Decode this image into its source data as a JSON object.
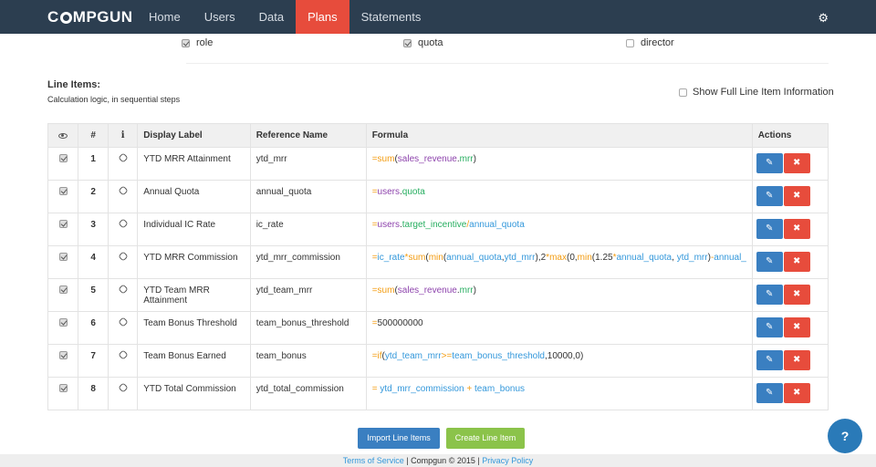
{
  "nav": {
    "brand": "COMPGUN",
    "items": [
      {
        "label": "Home",
        "active": false
      },
      {
        "label": "Users",
        "active": false
      },
      {
        "label": "Data",
        "active": false
      },
      {
        "label": "Plans",
        "active": true
      },
      {
        "label": "Statements",
        "active": false
      }
    ],
    "settings_icon": "gear-icon"
  },
  "fields": [
    {
      "label": "role",
      "checked": true
    },
    {
      "label": "quota",
      "checked": true
    },
    {
      "label": "director",
      "checked": false
    }
  ],
  "line_items": {
    "title": "Line Items:",
    "subtitle": "Calculation logic, in sequential steps",
    "show_full_label": "Show Full Line Item Information",
    "show_full_checked": false
  },
  "table": {
    "headers": {
      "visible_icon": "eye-icon",
      "num": "#",
      "info_icon": "info-icon",
      "display": "Display Label",
      "ref": "Reference Name",
      "formula": "Formula",
      "actions": "Actions"
    },
    "rows": [
      {
        "num": "1",
        "display": "YTD MRR Attainment",
        "ref": "ytd_mrr",
        "formula": "=sum(sales_revenue.mrr)"
      },
      {
        "num": "2",
        "display": "Annual Quota",
        "ref": "annual_quota",
        "formula": "=users.quota"
      },
      {
        "num": "3",
        "display": "Individual IC Rate",
        "ref": "ic_rate",
        "formula": "=users.target_incentive/annual_quota"
      },
      {
        "num": "4",
        "display": "YTD MRR Commission",
        "ref": "ytd_mrr_commission",
        "formula": "=ic_rate*sum(min(annual_quota,ytd_mrr),2*max(0,min(1.25*annual_quota, ytd_mrr)-annual_"
      },
      {
        "num": "5",
        "display": "YTD Team MRR Attainment",
        "ref": "ytd_team_mrr",
        "formula": "=sum(sales_revenue.mrr)"
      },
      {
        "num": "6",
        "display": "Team Bonus Threshold",
        "ref": "team_bonus_threshold",
        "formula": "=500000000"
      },
      {
        "num": "7",
        "display": "Team Bonus Earned",
        "ref": "team_bonus",
        "formula": "=if(ytd_team_mrr>=team_bonus_threshold,10000,0)"
      },
      {
        "num": "8",
        "display": "YTD Total Commission",
        "ref": "ytd_total_commission",
        "formula": "= ytd_mrr_commission + team_bonus"
      }
    ]
  },
  "buttons": {
    "import": "Import Line Items",
    "create": "Create Line Item"
  },
  "footer": {
    "terms": "Terms of Service",
    "middle": " | Compgun © 2015 | ",
    "privacy": "Privacy Policy"
  },
  "help_icon": "chat-help-icon"
}
